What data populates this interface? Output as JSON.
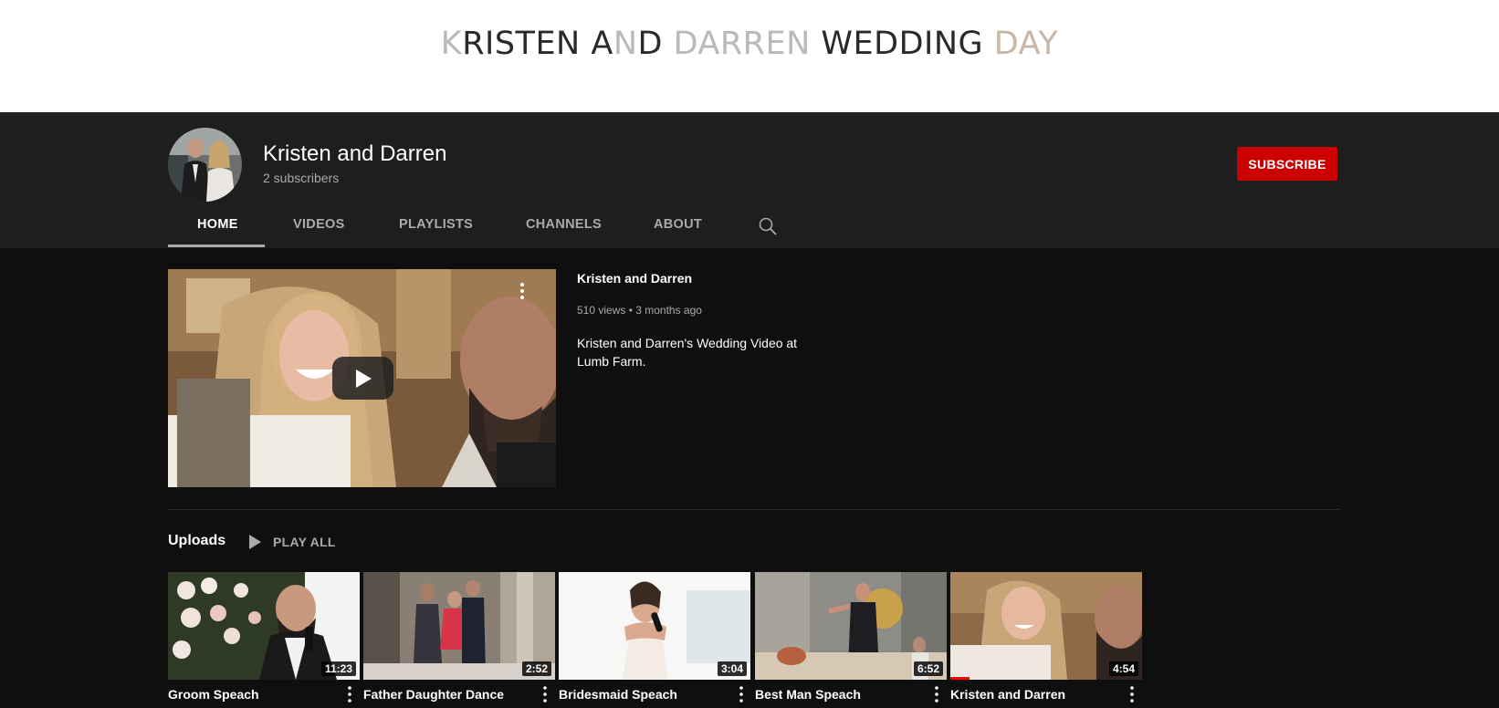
{
  "banner": {
    "title_left_fade": "K",
    "title_mid1": "RISTEN A",
    "title_fade2": "N",
    "title_mid2": "D ",
    "title_fade3": "DARREN",
    "title_mid3": " WEDDING ",
    "title_fade4": "DAY"
  },
  "channel": {
    "name": "Kristen and Darren",
    "subscribers": "2 subscribers",
    "subscribe_label": "SUBSCRIBE"
  },
  "tabs": [
    {
      "label": "HOME",
      "active": true
    },
    {
      "label": "VIDEOS"
    },
    {
      "label": "PLAYLISTS"
    },
    {
      "label": "CHANNELS"
    },
    {
      "label": "ABOUT"
    }
  ],
  "featured": {
    "title": "Kristen and Darren",
    "meta": "510 views • 3 months ago",
    "description": "Kristen and Darren's  Wedding Video at Lumb Farm."
  },
  "uploads": {
    "label": "Uploads",
    "play_all": "PLAY ALL",
    "videos": [
      {
        "title": "Groom Speach",
        "duration": "11:23"
      },
      {
        "title": "Father Daughter Dance",
        "duration": "2:52"
      },
      {
        "title": "Bridesmaid Speach",
        "duration": "3:04"
      },
      {
        "title": "Best Man Speach",
        "duration": "6:52"
      },
      {
        "title": "Kristen and Darren",
        "duration": "4:54",
        "progress": 0.1
      }
    ]
  },
  "colors": {
    "brand_red": "#cc0000",
    "background": "#0f0f0f",
    "header": "#1e1e1e"
  },
  "icons": [
    "search-icon",
    "play-icon",
    "more-vert-icon"
  ]
}
